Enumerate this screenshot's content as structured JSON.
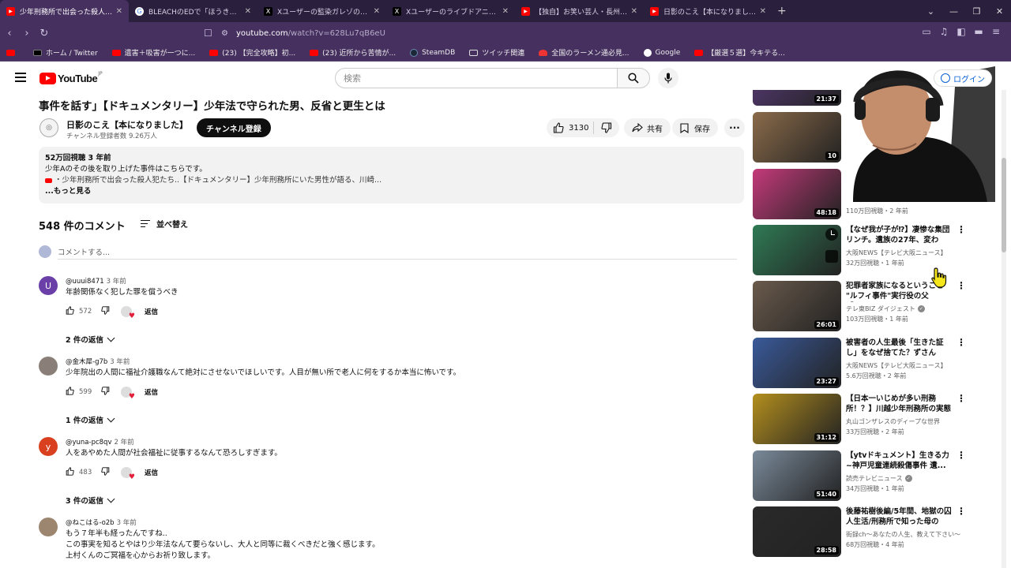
{
  "browser": {
    "tabs": [
      {
        "title": "少年刑務所で出会った殺人犯…川崎",
        "active": true,
        "icon": "youtube-icon",
        "icon_color": "#ff0000"
      },
      {
        "title": "BLEACHのEDで「ほうき星 - Google 検索",
        "active": false,
        "icon": "google-icon",
        "icon_color": "#ffffff"
      },
      {
        "title": "Xユーザーの監染ガレゾの悪報（兼業投",
        "active": false,
        "icon": "x-icon",
        "icon_color": "#000000"
      },
      {
        "title": "Xユーザーのライブドアニュースさん:「[容疑",
        "active": false,
        "icon": "x-icon",
        "icon_color": "#000000"
      },
      {
        "title": "【独自】お笑い芸人・長州小力さんを道交",
        "active": false,
        "icon": "youtube-icon",
        "icon_color": "#ff0000"
      },
      {
        "title": "日影のこえ【本になりました】- YouTube",
        "active": false,
        "icon": "youtube-icon",
        "icon_color": "#ff0000"
      }
    ],
    "url_host": "youtube.com",
    "url_path": "/watch?v=628Lu7qB6eU",
    "bookmarks": [
      {
        "label": "",
        "icon": "youtube-icon"
      },
      {
        "label": "ホーム / Twitter",
        "icon": "x-icon"
      },
      {
        "label": "遺害＋吸害が一つに...",
        "icon": "youtube-icon"
      },
      {
        "label": "(23) 【完全攻略】初...",
        "icon": "youtube-icon"
      },
      {
        "label": "(23) 近所から苦情が...",
        "icon": "youtube-icon"
      },
      {
        "label": "SteamDB",
        "icon": "steam-icon"
      },
      {
        "label": "ツイッチ関連",
        "icon": "folder-icon"
      },
      {
        "label": "全国のラーメン通必見...",
        "icon": "ramen-icon"
      },
      {
        "label": "Google",
        "icon": "google-icon"
      },
      {
        "label": "【厳選５選】今キテる...",
        "icon": "youtube-icon"
      }
    ]
  },
  "youtube": {
    "logo_text": "YouTube",
    "logo_region": "JP",
    "search_placeholder": "検索",
    "login_label": "ログイン"
  },
  "video": {
    "title": "事件を話す」【ドキュメンタリー】少年法で守られた男、反省と更生とは",
    "channel_name": "日影のこえ【本になりました】",
    "channel_subs": "チャンネル登録者数 9.26万人",
    "subscribe_label": "チャンネル登録",
    "likes": "3130",
    "share_label": "共有",
    "save_label": "保存",
    "description": {
      "meta": "52万回視聴  3 年前",
      "line2": "少年Aのその後を取り上げた事件はこちらです。",
      "line3": "・少年刑務所で出会った殺人犯たち..【ドキュメンタリー】少年刑務所にいた男性が語る、川崎...",
      "more": "...もっと見る"
    }
  },
  "comments_header": {
    "count": "548 件のコメント",
    "sort_label": "並べ替え",
    "add_placeholder": "コメントする..."
  },
  "comments": [
    {
      "author": "@uuui8471",
      "when": "3 年前",
      "text": [
        "年齢関係なく犯した罪を償うべき"
      ],
      "likes": "572",
      "reply_label": "返信",
      "replies": "2 件の返信",
      "avatar_letter": "U",
      "avatar_color": "#6b3fa8"
    },
    {
      "author": "@金木犀-g7b",
      "when": "3 年前",
      "text": [
        "少年院出の人間に福祉介護職なんて絶対にさせないでほしいです。人目が無い所で老人に何をするか本当に怖いです。"
      ],
      "likes": "599",
      "reply_label": "返信",
      "replies": "1 件の返信",
      "avatar_letter": "",
      "avatar_color": "#8a7f78"
    },
    {
      "author": "@yuna-pc8qv",
      "when": "2 年前",
      "text": [
        "人をあやめた人間が社会福祉に従事するなんて恐ろしすぎます。"
      ],
      "likes": "483",
      "reply_label": "返信",
      "replies": "3 件の返信",
      "avatar_letter": "y",
      "avatar_color": "#d8401f"
    },
    {
      "author": "@ねこはる-o2b",
      "when": "3 年前",
      "text": [
        "もう７年半も経ったんですね..",
        "この事実を知るとやはり少年法なんて要らないし、大人と同等に裁くべきだと強く感じます。",
        "上村くんのご冥福を心からお祈り致します。"
      ],
      "likes": "",
      "reply_label": "",
      "replies": "",
      "avatar_letter": "",
      "avatar_color": "#9c8670"
    }
  ],
  "recommendations": [
    {
      "title": "",
      "channel": "",
      "views": "",
      "duration": "21:37",
      "thumb_color": "#5a3b7a"
    },
    {
      "title": "",
      "channel": "",
      "views": "",
      "duration": "10",
      "thumb_color": "#8b6b4a"
    },
    {
      "title": "",
      "channel": "",
      "views": "110万回視聴・2 年前",
      "duration": "48:18",
      "thumb_color": "#c43a7a"
    },
    {
      "title": "【なぜ我が子が⁉】凄惨な集団リンチ。遺族の27年、変わら...",
      "channel": "大阪NEWS【テレビ大阪ニュース】",
      "views": "32万回視聴・1 年前",
      "duration": "",
      "thumb_color": "#2f7a55",
      "overlay_icons": true
    },
    {
      "title": "犯罪者家族になるということ \"ルフィ事件\"実行役の父【ザ...",
      "channel": "テレ東BIZ ダイジェスト",
      "views": "103万回視聴・1 年前",
      "duration": "26:01",
      "thumb_color": "#6a5a4c",
      "verified": true
    },
    {
      "title": "被害者の人生最後「生きた証し」をなぜ捨てた？ずさんな...",
      "channel": "大阪NEWS【テレビ大阪ニュース】",
      "views": "5.6万回視聴・2 年前",
      "duration": "23:27",
      "thumb_color": "#3a5a9a"
    },
    {
      "title": "【日本一いじめが多い刑務所！？】川越少年刑務所の実態",
      "channel": "丸山ゴンザレスのディープな世界",
      "views": "33万回視聴・2 年前",
      "duration": "31:12",
      "thumb_color": "#b38f1e"
    },
    {
      "title": "【ytvドキュメント】生きる力 ~神戸児童連続殺傷事件 遺...",
      "channel": "読売テレビニュース",
      "views": "34万回視聴・1 年前",
      "duration": "51:40",
      "thumb_color": "#7a8a9a",
      "verified": true
    },
    {
      "title": "後藤祐樹後編/5年間、地獄の囚人生活/刑務所で知った母の死...",
      "channel": "街録ch〜あなたの人生、教えて下さい〜",
      "views": "68万回視聴・4 年前",
      "duration": "28:58",
      "thumb_color": "#2a2a2a"
    }
  ]
}
